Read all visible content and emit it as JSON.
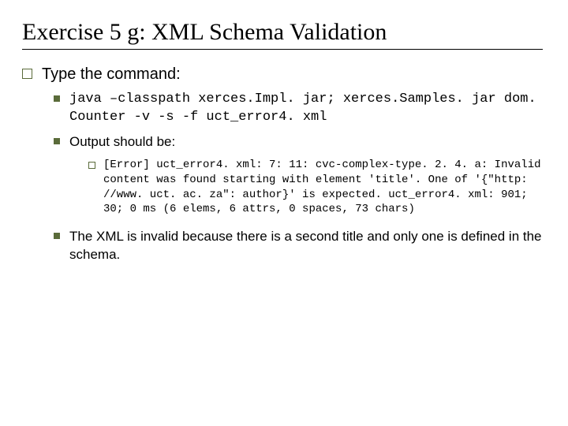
{
  "title": "Exercise 5 g: XML Schema Validation",
  "l1": "Type the command:",
  "cmd": "java –classpath xerces.Impl. jar; xerces.Samples. jar dom. Counter -v -s -f uct_error4. xml",
  "out_label": "Output should be:",
  "out_text": "[Error] uct_error4. xml: 7: 11: cvc-complex-type. 2. 4. a: Invalid content was found starting with element 'title'. One of '{\"http: //www. uct. ac. za\": author}' is expected. uct_error4. xml: 901; 30; 0 ms (6 elems, 6 attrs, 0 spaces, 73 chars)",
  "explain": "The XML is invalid because there is a second title and only one is defined in the schema."
}
